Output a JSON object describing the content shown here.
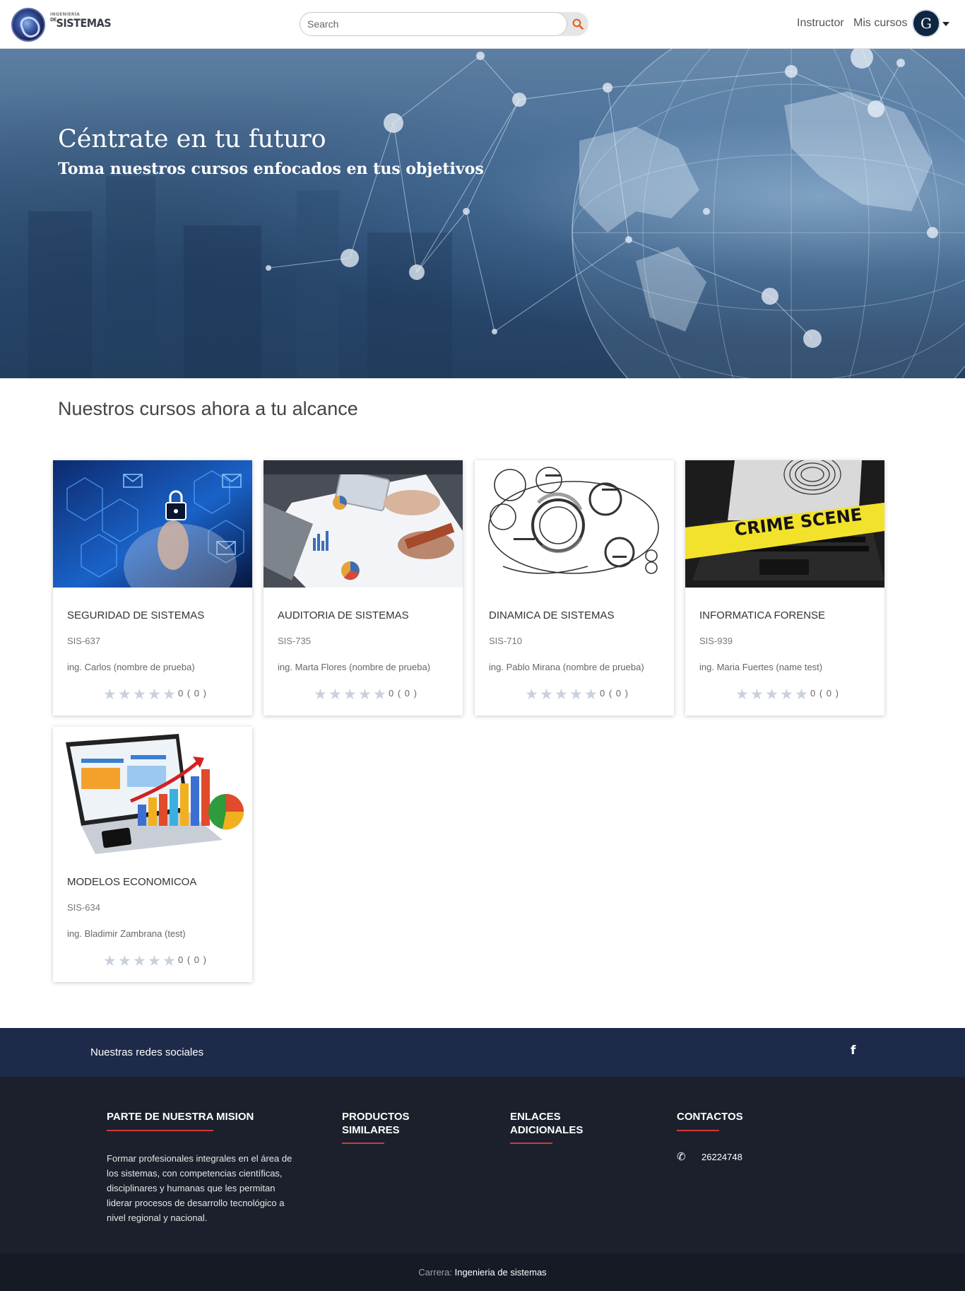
{
  "navbar": {
    "brand_small": "INGENIERÍA",
    "brand_de": "DE",
    "brand_big": "SISTEMAS",
    "search_placeholder": "Search",
    "links": [
      "Instructor",
      "Mis cursos"
    ],
    "avatar_letter": "G"
  },
  "hero": {
    "title": "Céntrate en tu futuro",
    "subtitle": "Toma nuestros cursos enfocados en tus objetivos"
  },
  "section": {
    "title": "Nuestros cursos ahora a tu alcance"
  },
  "courses": [
    {
      "title": "SEGURIDAD DE SISTEMAS",
      "code": "SIS-637",
      "teacher": "ing. Carlos (nombre de prueba)",
      "rating": 0,
      "reviews_text": "0 ( 0 )",
      "image": "security-lock-image"
    },
    {
      "title": "AUDITORIA DE SISTEMAS",
      "code": "SIS-735",
      "teacher": "ing. Marta Flores (nombre de prueba)",
      "rating": 0,
      "reviews_text": "0 ( 0 )",
      "image": "business-meeting-image"
    },
    {
      "title": "DINAMICA DE SISTEMAS",
      "code": "SIS-710",
      "teacher": "ing. Pablo Mirana (nombre de prueba)",
      "rating": 0,
      "reviews_text": "0 ( 0 )",
      "image": "systems-diagram-image"
    },
    {
      "title": "INFORMATICA FORENSE",
      "code": "SIS-939",
      "teacher": "ing. Maria Fuertes (name test)",
      "rating": 0,
      "reviews_text": "0 ( 0 )",
      "image": "crime-scene-laptop-image"
    },
    {
      "title": "MODELOS ECONOMICOA",
      "code": "SIS-634",
      "teacher": "ing. Bladimir Zambrana (test)",
      "rating": 0,
      "reviews_text": "0 ( 0 )",
      "image": "laptop-charts-image"
    }
  ],
  "images": {
    "crime_tape": "CRIME SCENE"
  },
  "social": {
    "text": "Nuestras redes sociales",
    "icon": "facebook-icon"
  },
  "footer": {
    "mission_title": "PARTE DE NUESTRA MISION",
    "mission_text": "Formar profesionales integrales en el área de los sistemas, con competencias científicas, disciplinares y humanas que les permitan liderar procesos de desarrollo tecnológico a nivel regional y nacional.",
    "products_title_1": "PRODUCTOS",
    "products_title_2": "SIMILARES",
    "links_title_1": "ENLACES",
    "links_title_2": "ADICIONALES",
    "contacts_title": "CONTACTOS",
    "phone": "26224748"
  },
  "bottom": {
    "label": "Carrera:",
    "value": "Ingenieria de sistemas"
  },
  "colors": {
    "accent_orange": "#e8601c",
    "footer_line_red": "#d13a3a",
    "social_bar": "#1e2a4a",
    "footer_bg": "#1b202c"
  }
}
